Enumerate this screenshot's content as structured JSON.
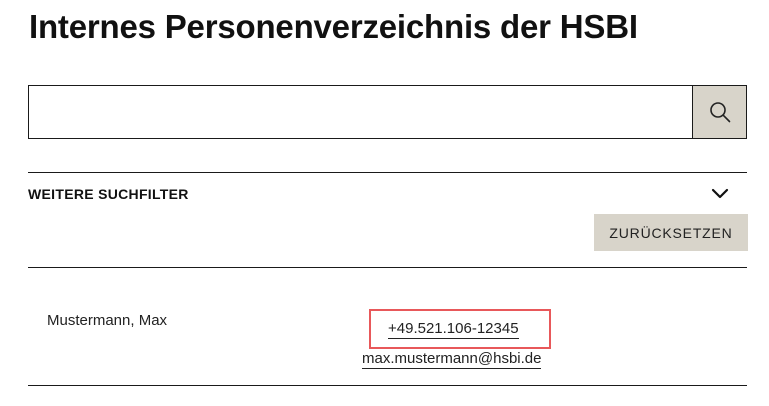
{
  "page": {
    "title": "Internes Personenverzeichnis der HSBI"
  },
  "search": {
    "value": "",
    "placeholder": "",
    "button_icon": "search-icon"
  },
  "filters": {
    "label": "WEITERE SUCHFILTER",
    "toggle_icon": "chevron-down-icon",
    "reset_label": "ZURÜCKSETZEN"
  },
  "results": [
    {
      "name": "Mustermann, Max",
      "phone": "+49.521.106-12345",
      "email": "max.mustermann@hsbi.de"
    }
  ],
  "colors": {
    "text": "#111111",
    "button_bg": "#d8d4ca",
    "highlight": "#e8585a",
    "rule": "#1a1a1a"
  }
}
